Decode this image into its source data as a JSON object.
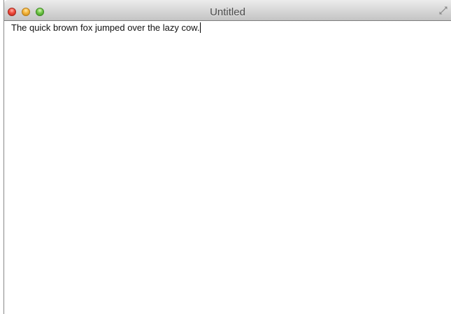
{
  "window": {
    "title": "Untitled",
    "controls": {
      "close_icon": "close-icon",
      "minimize_icon": "minimize-icon",
      "zoom_icon": "zoom-icon",
      "fullscreen_icon": "fullscreen-icon"
    },
    "colors": {
      "close": "#f04a3c",
      "minimize": "#f5b53a",
      "zoom": "#6fc646",
      "titlebar_top": "#ececec",
      "titlebar_bottom": "#c4c4c4"
    }
  },
  "editor": {
    "text": "The quick brown fox jumped over the lazy cow."
  }
}
